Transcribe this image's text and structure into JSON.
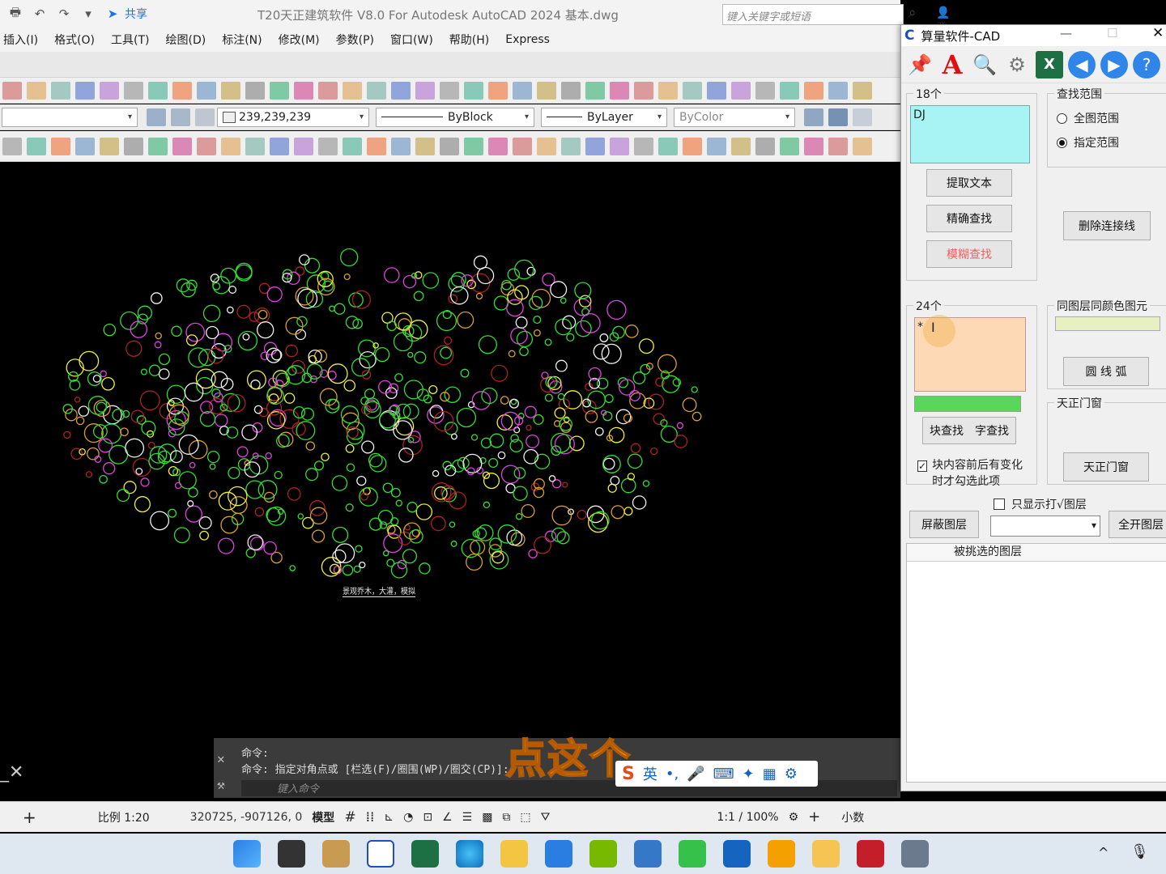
{
  "titlebar": {
    "share": "共享",
    "title": "T20天正建筑软件 V8.0 For Autodesk AutoCAD 2024    基本.dwg",
    "search_placeholder": "键入关键字或短语",
    "login": "登录"
  },
  "menubar": [
    "插入(I)",
    "格式(O)",
    "工具(T)",
    "绘图(D)",
    "标注(N)",
    "修改(M)",
    "参数(P)",
    "窗口(W)",
    "帮助(H)",
    "Express"
  ],
  "props": {
    "color": "239,239,239",
    "linetype": "ByBlock",
    "lineweight": "ByLayer",
    "plotstyle": "ByColor"
  },
  "canvas": {
    "label": "景观乔木，大灌，模拟"
  },
  "command": {
    "line1": "命令:",
    "line2": "命令: 指定对角点或 [栏选(F)/圈围(WP)/圈交(CP)]:",
    "placeholder": "键入命令"
  },
  "subtitle": "点这个",
  "ime": {
    "lang": "英",
    "punct": "•,"
  },
  "statusbar": {
    "scale": "比例 1:20",
    "coords": "320725, -907126, 0",
    "model": "模型",
    "annoscale": "1:1 / 100%",
    "units": "小数"
  },
  "plugin": {
    "title": "算量软件-CAD",
    "group1_caption": "18个",
    "text1_value": "DJ",
    "extract_text": "提取文本",
    "exact_find": "精确查找",
    "fuzzy_find": "模糊查找",
    "scope_caption": "查找范围",
    "scope_all": "全图范围",
    "scope_specified": "指定范围",
    "delete_connector": "删除连接线",
    "group2_caption": "24个",
    "text2_value": "*",
    "block_find": "块查找",
    "text_find": "字查找",
    "checkbox_label": "块内容前后有变化时才勾选此项",
    "samelayer_caption": "同图层同颜色图元",
    "circle_arc": "圆 线 弧",
    "tz_caption": "天正门窗",
    "tz_button": "天正门窗",
    "only_show_label": "只显示打√图层",
    "hide_layer": "屏蔽图层",
    "open_all_layer": "全开图层",
    "selected_layers": "被挑选的图层"
  },
  "colors": {
    "plugin_cyan": "#a8f4f4",
    "plugin_peach": "#fdd9b5",
    "progress_green": "#5ad65a",
    "cad_green": "#33dd33",
    "cad_magenta": "#dd44dd",
    "cad_orange": "#d9a030",
    "cad_yellow": "#f0f040"
  }
}
